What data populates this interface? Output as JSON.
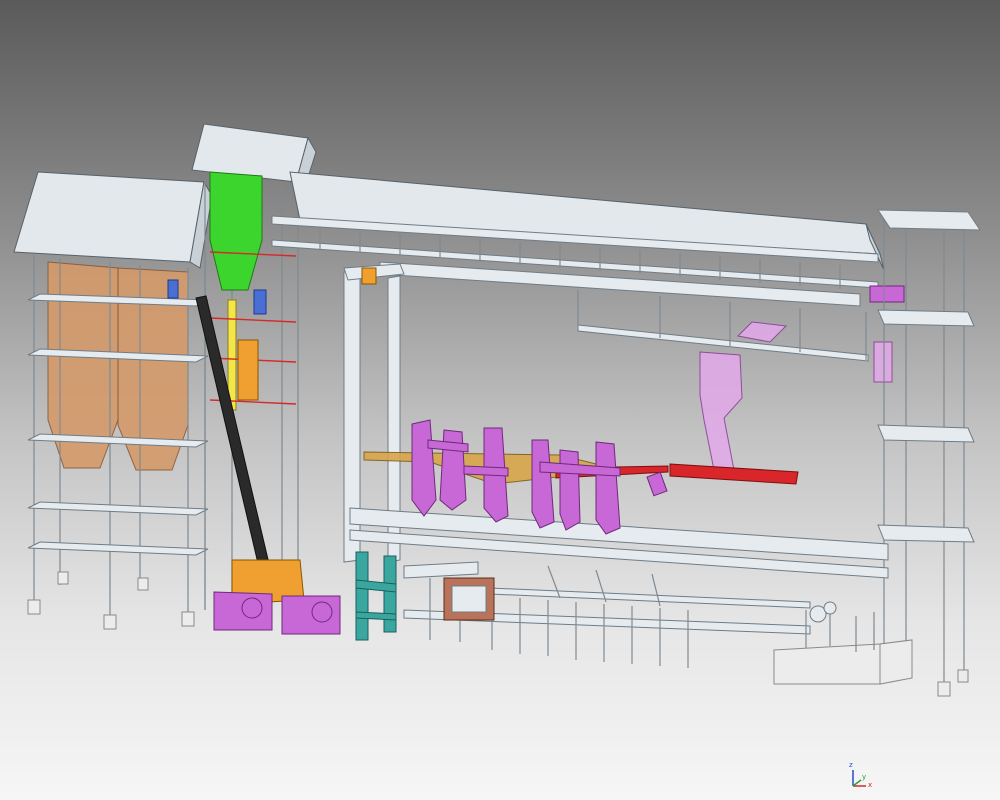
{
  "viewport": {
    "background_top": "#5a5a5a",
    "background_bottom": "#f6f6f6"
  },
  "axis_triad": {
    "x_label": "x",
    "y_label": "y",
    "z_label": "z",
    "x_color": "#d42a2a",
    "y_color": "#2aa02a",
    "z_color": "#2a4ad4"
  },
  "colors": {
    "structure": "#e6ebef",
    "silo": "#d49a6a",
    "equipment_magenta": "#c768d6",
    "drive_orange": "#f0a030",
    "elevator_green": "#3cd52e",
    "frame_teal": "#3aa6a0",
    "conveyor_red": "#d8262a",
    "belt_gold": "#d7a64a"
  }
}
